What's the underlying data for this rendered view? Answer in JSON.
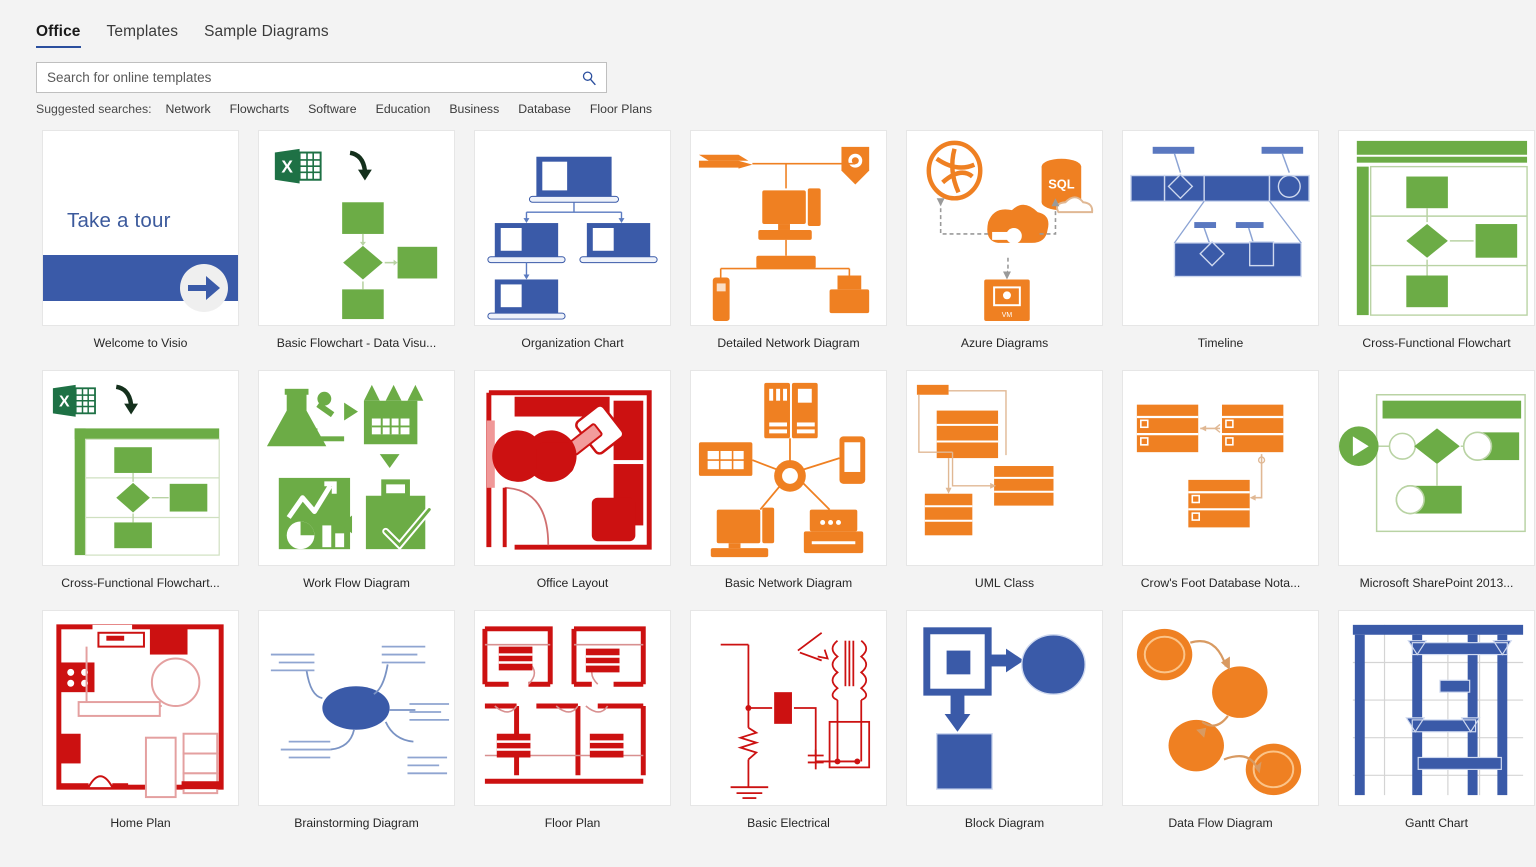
{
  "tabs": [
    {
      "label": "Office",
      "active": true
    },
    {
      "label": "Templates",
      "active": false
    },
    {
      "label": "Sample Diagrams",
      "active": false
    }
  ],
  "search": {
    "placeholder": "Search for online templates",
    "value": "",
    "icon": "search-icon"
  },
  "suggested": {
    "label": "Suggested searches:",
    "items": [
      "Network",
      "Flowcharts",
      "Software",
      "Education",
      "Business",
      "Database",
      "Floor Plans"
    ]
  },
  "colors": {
    "background": "#f3f3f3",
    "tile": "#ffffff",
    "accent_blue": "#2b4f9e",
    "visio_blue": "#3a5aa8",
    "green": "#6cac46",
    "orange": "#ef8022",
    "red": "#cc1111",
    "excel_green": "#1e7145"
  },
  "templates": [
    {
      "label": "Welcome to Visio",
      "art": "welcome"
    },
    {
      "label": "Basic Flowchart - Data Visu...",
      "art": "basic-flowchart-data"
    },
    {
      "label": "Organization Chart",
      "art": "org-chart"
    },
    {
      "label": "Detailed Network Diagram",
      "art": "detailed-network"
    },
    {
      "label": "Azure Diagrams",
      "art": "azure"
    },
    {
      "label": "Timeline",
      "art": "timeline"
    },
    {
      "label": "Cross-Functional Flowchart",
      "art": "cross-functional"
    },
    {
      "label": "Cross-Functional Flowchart...",
      "art": "cross-functional-data"
    },
    {
      "label": "Work Flow Diagram",
      "art": "work-flow"
    },
    {
      "label": "Office Layout",
      "art": "office-layout"
    },
    {
      "label": "Basic Network Diagram",
      "art": "basic-network"
    },
    {
      "label": "UML Class",
      "art": "uml-class"
    },
    {
      "label": "Crow's Foot Database Nota...",
      "art": "crows-foot"
    },
    {
      "label": "Microsoft SharePoint 2013...",
      "art": "sharepoint"
    },
    {
      "label": "Home Plan",
      "art": "home-plan"
    },
    {
      "label": "Brainstorming Diagram",
      "art": "brainstorming"
    },
    {
      "label": "Floor Plan",
      "art": "floor-plan"
    },
    {
      "label": "Basic Electrical",
      "art": "basic-electrical"
    },
    {
      "label": "Block Diagram",
      "art": "block-diagram"
    },
    {
      "label": "Data Flow Diagram",
      "art": "data-flow"
    },
    {
      "label": "Gantt Chart",
      "art": "gantt-chart"
    }
  ],
  "tile_text": {
    "take_a_tour": "Take a tour",
    "excel_x": "X",
    "sql": "SQL",
    "vm": "VM"
  }
}
